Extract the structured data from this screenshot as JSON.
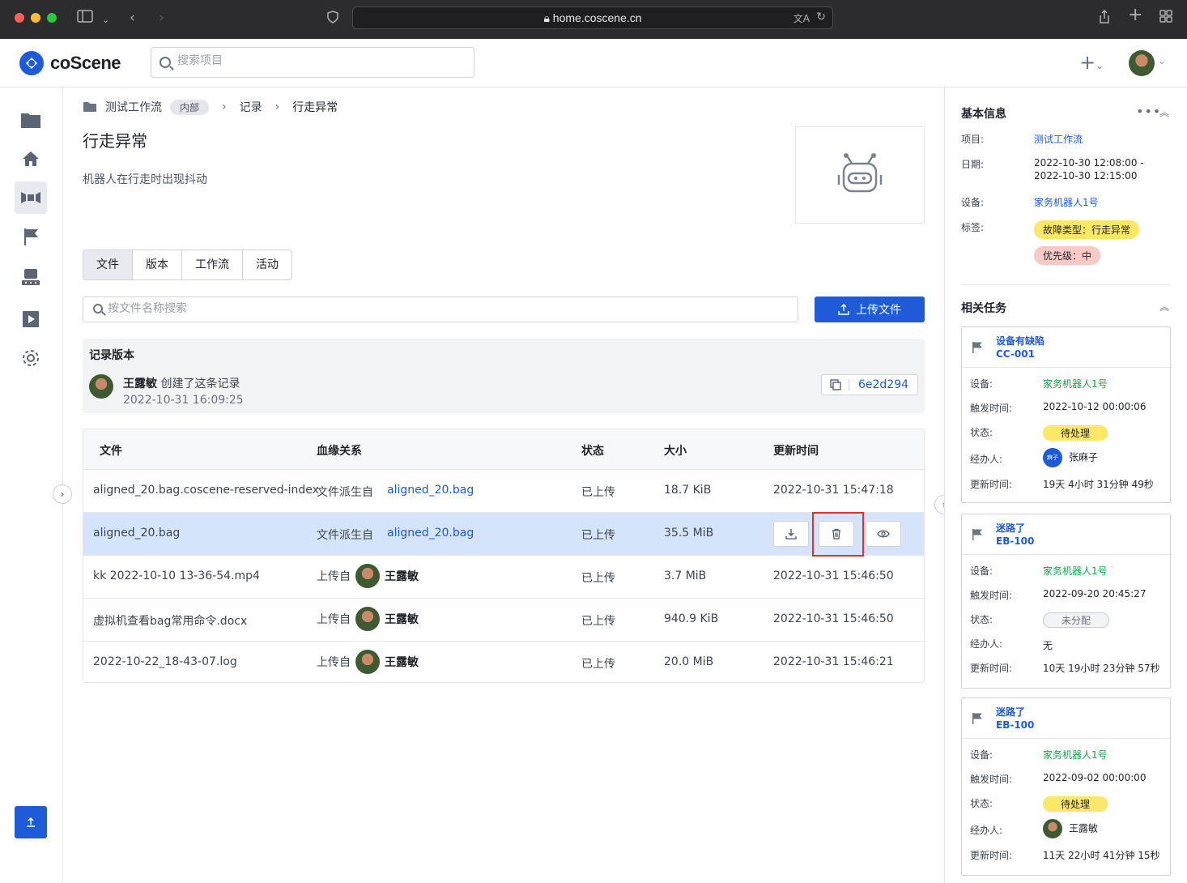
{
  "browser": {
    "url": "home.coscene.cn"
  },
  "header": {
    "logo_text": "coScene",
    "search_placeholder": "搜索项目"
  },
  "breadcrumb": {
    "project": "测试工作流",
    "project_tag": "内部",
    "section": "记录",
    "current": "行走异常"
  },
  "record": {
    "title": "行走异常",
    "description": "机器人在行走时出现抖动"
  },
  "tabs": [
    "文件",
    "版本",
    "工作流",
    "活动"
  ],
  "files_search": {
    "placeholder": "按文件名称搜索",
    "upload_label": "上传文件"
  },
  "version": {
    "title": "记录版本",
    "user": "王露敏",
    "action": "创建了这条记录",
    "time": "2022-10-31 16:09:25",
    "commit": "6e2d294"
  },
  "table": {
    "columns": [
      "文件",
      "血缘关系",
      "状态",
      "大小",
      "更新时间"
    ],
    "rows": [
      {
        "name": "aligned_20.bag.coscene-reserved-index",
        "lineage_prefix": "文件派生自",
        "lineage_target": "aligned_20.bag",
        "status": "已上传",
        "size": "18.7 KiB",
        "updated": "2022-10-31 15:47:18"
      },
      {
        "name": "aligned_20.bag",
        "lineage_prefix": "文件派生自",
        "lineage_target": "aligned_20.bag",
        "status": "已上传",
        "size": "35.5 MiB",
        "updated": ""
      },
      {
        "name": "kk 2022-10-10 13-36-54.mp4",
        "lineage_prefix": "上传自",
        "lineage_target": "王露敏",
        "status": "已上传",
        "size": "3.7 MiB",
        "updated": "2022-10-31 15:46:50"
      },
      {
        "name": "虚拟机查看bag常用命令.docx",
        "lineage_prefix": "上传自",
        "lineage_target": "王露敏",
        "status": "已上传",
        "size": "940.9 KiB",
        "updated": "2022-10-31 15:46:50"
      },
      {
        "name": "2022-10-22_18-43-07.log",
        "lineage_prefix": "上传自",
        "lineage_target": "王露敏",
        "status": "已上传",
        "size": "20.0 MiB",
        "updated": "2022-10-31 15:46:21"
      }
    ]
  },
  "info": {
    "title": "基本信息",
    "project_label": "项目:",
    "project_value": "测试工作流",
    "date_label": "日期:",
    "date_start": "2022-10-30 12:08:00 -",
    "date_end": "2022-10-30 12:15:00",
    "device_label": "设备:",
    "device_value": "家务机器人1号",
    "tags_label": "标签:",
    "tag1": "故障类型：行走异常",
    "tag2": "优先级：中"
  },
  "tasks": {
    "title": "相关任务",
    "labels": {
      "device": "设备:",
      "trigger": "触发时间:",
      "status": "状态:",
      "assignee": "经办人:",
      "updated": "更新时间:"
    },
    "items": [
      {
        "title": "设备有缺陷",
        "code": "CC-001",
        "device": "家务机器人1号",
        "trigger": "2022-10-12 00:00:06",
        "status": "待处理",
        "assignee": "张麻子",
        "assignee_badge": "麻子",
        "updated": "19天 4小时 31分钟 49秒"
      },
      {
        "title": "迷路了",
        "code": "EB-100",
        "device": "家务机器人1号",
        "trigger": "2022-09-20 20:45:27",
        "status": "未分配",
        "assignee": "无",
        "updated": "10天 19小时 23分钟 57秒"
      },
      {
        "title": "迷路了",
        "code": "EB-100",
        "device": "家务机器人1号",
        "trigger": "2022-09-02 00:00:00",
        "status": "待处理",
        "assignee": "王露敏",
        "updated": "11天 22小时 41分钟 15秒"
      }
    ]
  },
  "colors": {
    "primary": "#1d5bd8",
    "selected_row": "#d6e4fb",
    "highlight": "#e03131",
    "tag_yellow": "#fde767",
    "tag_red": "#f9c9c6",
    "green": "#16a34a"
  }
}
